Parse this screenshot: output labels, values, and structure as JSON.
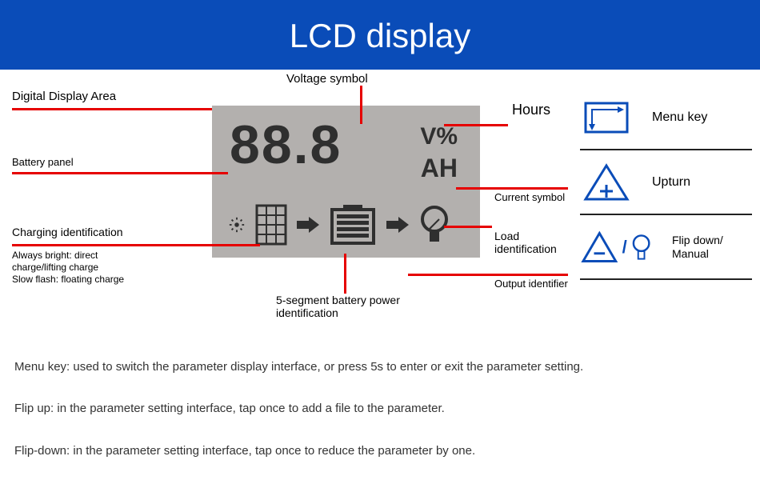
{
  "header": {
    "title": "LCD display"
  },
  "lcd": {
    "digits": "88.8",
    "v_percent": "V%",
    "ah": "AH"
  },
  "labels": {
    "digital_display": "Digital Display Area",
    "voltage_symbol": "Voltage symbol",
    "battery_panel": "Battery panel",
    "charging_id": "Charging identification",
    "charging_note1": "Always bright: direct charge/lifting charge",
    "charging_note2": "Slow flash: floating charge",
    "segment": "5-segment battery power identification",
    "hours": "Hours",
    "current_symbol": "Current symbol",
    "load_id": "Load identification",
    "output_id": "Output identifier"
  },
  "right": {
    "menu_key": "Menu key",
    "upturn": "Upturn",
    "flip_down": "Flip down/ Manual"
  },
  "descriptions": {
    "menu": "Menu key: used to switch the parameter display interface, or press 5s to enter or exit the parameter setting.",
    "flip_up": "Flip up: in the parameter setting interface, tap once to add a file to the parameter.",
    "flip_down": "Flip-down: in the parameter setting interface, tap once to reduce the parameter by one."
  }
}
